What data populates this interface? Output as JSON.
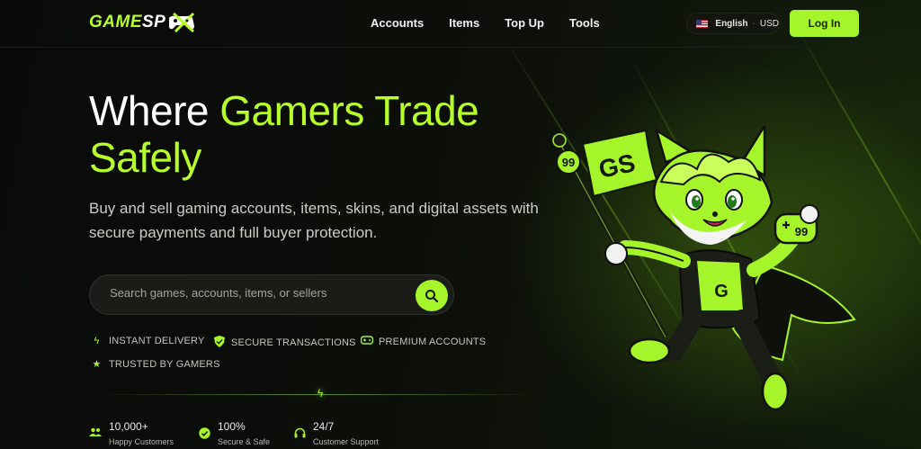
{
  "header": {
    "logo_part1": "GAME",
    "logo_part2": "SP",
    "nav": [
      "Accounts",
      "Items",
      "Top Up",
      "Tools"
    ],
    "language": "English",
    "currency": "USD",
    "login_label": "Log In"
  },
  "hero": {
    "title_white": "Where ",
    "title_green_1": "Gamers Trade",
    "title_green_2": "Safely",
    "subtitle": "Buy and sell gaming accounts, items, skins, and digital assets with secure payments and full buyer protection.",
    "search_placeholder": "Search games, accounts, items, or sellers"
  },
  "features": [
    {
      "icon": "bolt-icon",
      "label": "INSTANT DELIVERY"
    },
    {
      "icon": "shield-check-icon",
      "label": "SECURE TRANSACTIONS"
    },
    {
      "icon": "gamepad-icon",
      "label": "PREMIUM ACCOUNTS"
    },
    {
      "icon": "star-icon",
      "label": "TRUSTED BY GAMERS"
    }
  ],
  "stats": [
    {
      "icon": "users-icon",
      "value": "10,000+",
      "label": "Happy Customers"
    },
    {
      "icon": "verified-icon",
      "value": "100%",
      "label": "Secure & Safe"
    },
    {
      "icon": "headset-icon",
      "value": "24/7",
      "label": "Customer Support"
    }
  ],
  "mascot": {
    "flag_text": "GS",
    "badge_text": "99",
    "shirt_letter": "G"
  },
  "colors": {
    "accent": "#a6f52a",
    "background": "#0b0d0a"
  }
}
